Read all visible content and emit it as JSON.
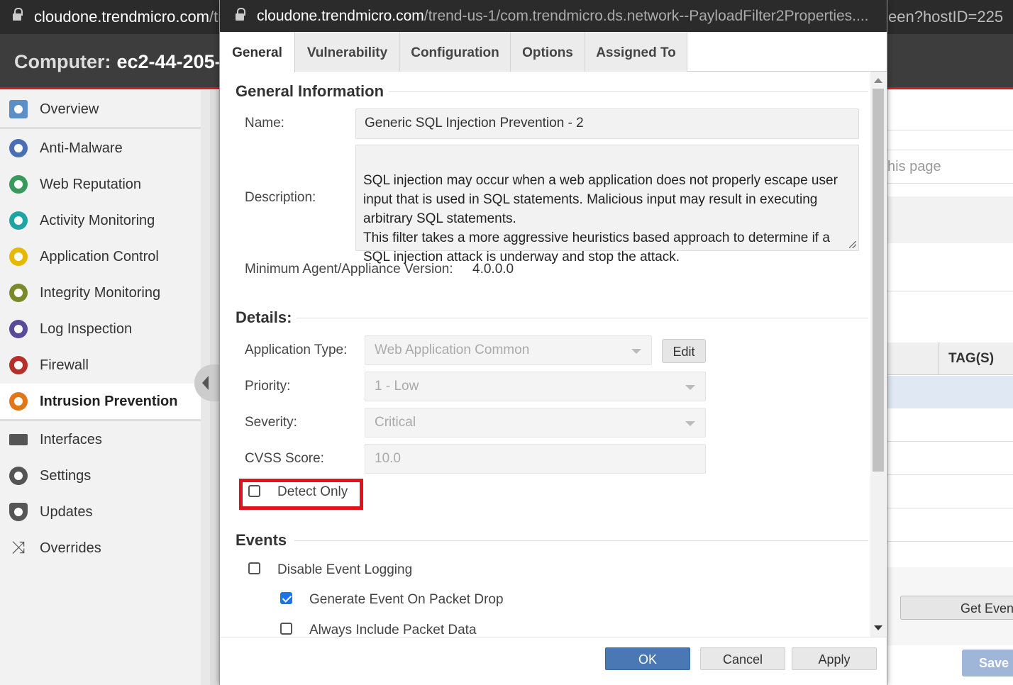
{
  "background": {
    "url_host": "cloudone.trendmicro.com",
    "url_path_fragment": "/tr",
    "url_right_fragment": "een?hostID=225",
    "header_label": "Computer:",
    "header_value": "ec2-44-205-",
    "sidebar": {
      "items": [
        {
          "label": "Overview",
          "icon": "overview-icon"
        },
        {
          "label": "Anti-Malware",
          "icon": "anti-malware-icon"
        },
        {
          "label": "Web Reputation",
          "icon": "web-reputation-icon"
        },
        {
          "label": "Activity Monitoring",
          "icon": "activity-monitoring-icon"
        },
        {
          "label": "Application Control",
          "icon": "application-control-icon"
        },
        {
          "label": "Integrity Monitoring",
          "icon": "integrity-monitoring-icon"
        },
        {
          "label": "Log Inspection",
          "icon": "log-inspection-icon"
        },
        {
          "label": "Firewall",
          "icon": "firewall-icon"
        },
        {
          "label": "Intrusion Prevention",
          "icon": "intrusion-prevention-icon"
        },
        {
          "label": "Interfaces",
          "icon": "interfaces-icon"
        },
        {
          "label": "Settings",
          "icon": "gear-icon"
        },
        {
          "label": "Updates",
          "icon": "updates-icon"
        },
        {
          "label": "Overrides",
          "icon": "shuffle-icon"
        }
      ],
      "active": "Intrusion Prevention"
    },
    "search_placeholder_fragment": "his page",
    "column_header": "TAG(S)",
    "get_events_button": "Get Event",
    "save_button": "Save"
  },
  "dialog": {
    "url_host": "cloudone.trendmicro.com",
    "url_path": "/trend-us-1/com.trendmicro.ds.network--PayloadFilter2Properties....",
    "tabs": [
      "General",
      "Vulnerability",
      "Configuration",
      "Options",
      "Assigned To"
    ],
    "active_tab": "General",
    "general_information": {
      "title": "General Information",
      "name_label": "Name:",
      "name_value": "Generic SQL Injection Prevention - 2",
      "description_label": "Description:",
      "description_value": "SQL injection may occur when a web application does not properly escape user input that is used in SQL statements. Malicious input may result in executing arbitrary SQL statements.\nThis filter takes a more aggressive heuristics based approach to determine if a SQL injection attack is underway and stop the attack.",
      "min_version_label": "Minimum Agent/Appliance Version:",
      "min_version_value": "4.0.0.0"
    },
    "details": {
      "title": "Details:",
      "application_type_label": "Application Type:",
      "application_type_value": "Web Application Common",
      "edit_button": "Edit",
      "priority_label": "Priority:",
      "priority_value": "1 - Low",
      "severity_label": "Severity:",
      "severity_value": "Critical",
      "cvss_label": "CVSS Score:",
      "cvss_value": "10.0",
      "detect_only_label": "Detect Only",
      "detect_only_checked": false
    },
    "events": {
      "title": "Events",
      "disable_logging_label": "Disable Event Logging",
      "disable_logging_checked": false,
      "generate_on_drop_label": "Generate Event On Packet Drop",
      "generate_on_drop_checked": true,
      "include_packet_label": "Always Include Packet Data",
      "include_packet_checked": false
    },
    "footer": {
      "ok": "OK",
      "cancel": "Cancel",
      "apply": "Apply"
    },
    "colors": {
      "accent": "#4a78b5",
      "highlight": "#e0131a",
      "header_bar": "#d71920"
    }
  }
}
